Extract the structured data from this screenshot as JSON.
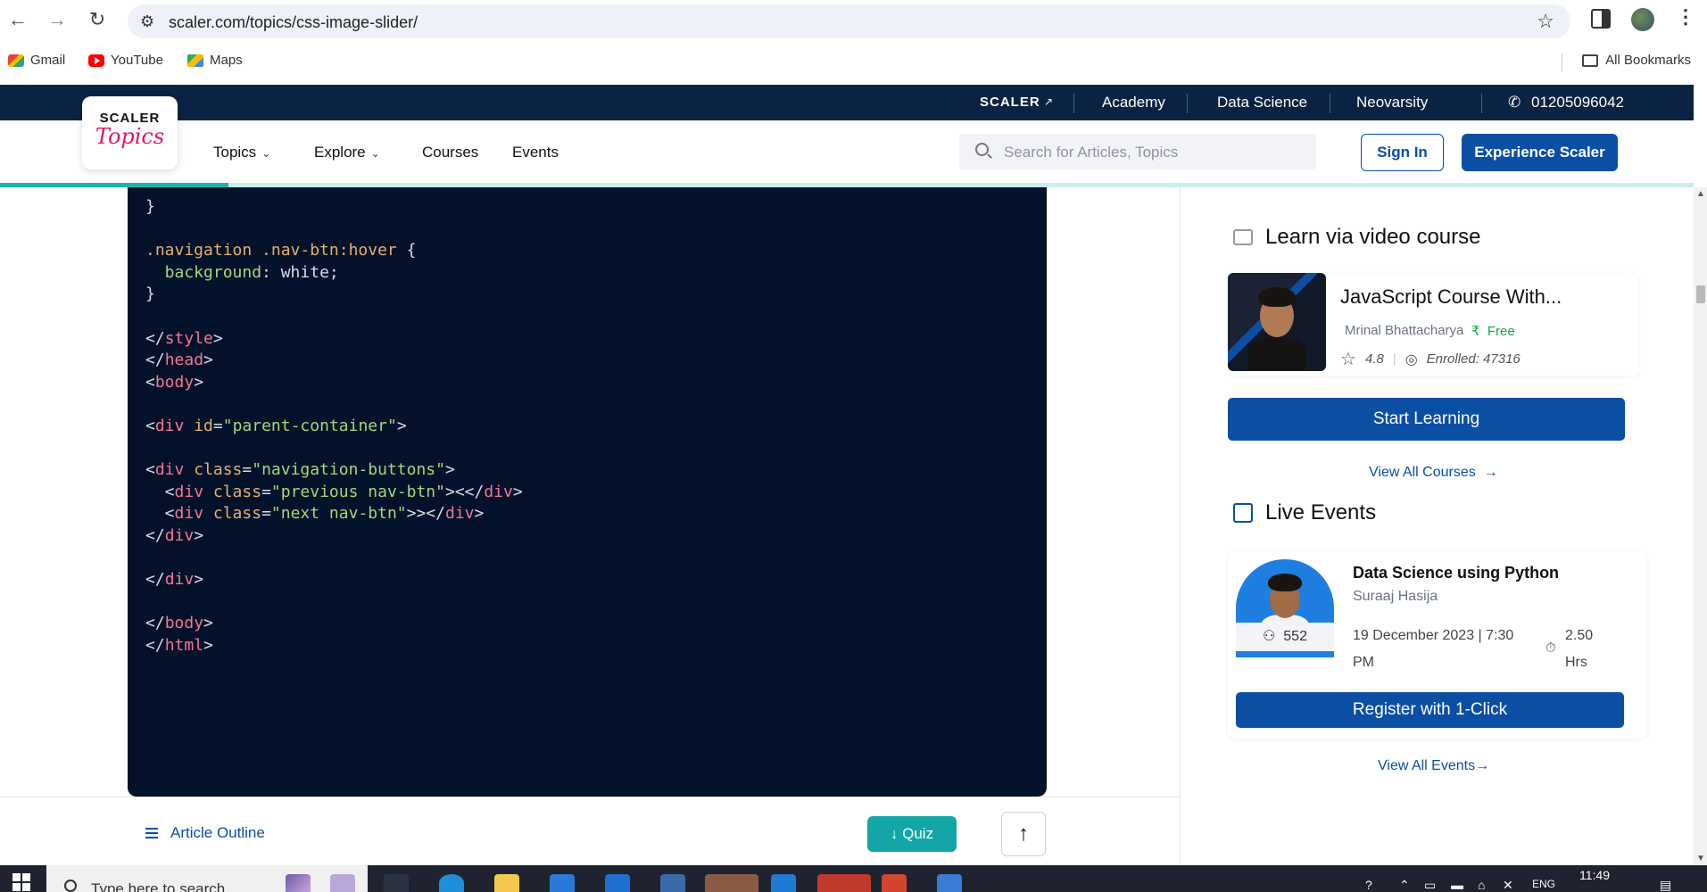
{
  "browser": {
    "url": "scaler.com/topics/css-image-slider/",
    "bookmarks": [
      "Gmail",
      "YouTube",
      "Maps"
    ],
    "all_bookmarks_label": "All Bookmarks"
  },
  "topstrip": {
    "logo": "SCALER",
    "links": [
      "Academy",
      "Data Science",
      "Neovarsity"
    ],
    "phone": "01205096042"
  },
  "nav": {
    "brand_top": "SCALER",
    "brand_bottom": "Topics",
    "items": [
      "Topics",
      "Explore",
      "Courses",
      "Events"
    ],
    "search_placeholder": "Search for Articles, Topics",
    "signin_label": "Sign In",
    "experience_label": "Experience Scaler"
  },
  "reading_progress": 0.135,
  "code_lines": [
    [
      {
        "t": "}",
        "c": "plain"
      }
    ],
    [],
    [
      {
        "t": ".navigation .nav-btn:hover",
        "c": "sel"
      },
      {
        "t": " {",
        "c": "plain"
      }
    ],
    [
      {
        "t": "  background",
        "c": "prop"
      },
      {
        "t": ": white;",
        "c": "plain"
      }
    ],
    [
      {
        "t": "}",
        "c": "plain"
      }
    ],
    [],
    [
      {
        "t": "</",
        "c": "plain"
      },
      {
        "t": "style",
        "c": "tag"
      },
      {
        "t": ">",
        "c": "plain"
      }
    ],
    [
      {
        "t": "</",
        "c": "plain"
      },
      {
        "t": "head",
        "c": "tag"
      },
      {
        "t": ">",
        "c": "plain"
      }
    ],
    [
      {
        "t": "<",
        "c": "plain"
      },
      {
        "t": "body",
        "c": "tag"
      },
      {
        "t": ">",
        "c": "plain"
      }
    ],
    [],
    [
      {
        "t": "<",
        "c": "plain"
      },
      {
        "t": "div",
        "c": "tag"
      },
      {
        "t": " ",
        "c": "plain"
      },
      {
        "t": "id",
        "c": "attr"
      },
      {
        "t": "=",
        "c": "plain"
      },
      {
        "t": "\"parent-container\"",
        "c": "str"
      },
      {
        "t": ">",
        "c": "plain"
      }
    ],
    [],
    [
      {
        "t": "<",
        "c": "plain"
      },
      {
        "t": "div",
        "c": "tag"
      },
      {
        "t": " ",
        "c": "plain"
      },
      {
        "t": "class",
        "c": "attr"
      },
      {
        "t": "=",
        "c": "plain"
      },
      {
        "t": "\"navigation-buttons\"",
        "c": "str"
      },
      {
        "t": ">",
        "c": "plain"
      }
    ],
    [
      {
        "t": "  <",
        "c": "plain"
      },
      {
        "t": "div",
        "c": "tag"
      },
      {
        "t": " ",
        "c": "plain"
      },
      {
        "t": "class",
        "c": "attr"
      },
      {
        "t": "=",
        "c": "plain"
      },
      {
        "t": "\"previous nav-btn\"",
        "c": "str"
      },
      {
        "t": "><</",
        "c": "plain"
      },
      {
        "t": "div",
        "c": "tag"
      },
      {
        "t": ">",
        "c": "plain"
      }
    ],
    [
      {
        "t": "  <",
        "c": "plain"
      },
      {
        "t": "div",
        "c": "tag"
      },
      {
        "t": " ",
        "c": "plain"
      },
      {
        "t": "class",
        "c": "attr"
      },
      {
        "t": "=",
        "c": "plain"
      },
      {
        "t": "\"next nav-btn\"",
        "c": "str"
      },
      {
        "t": ">></",
        "c": "plain"
      },
      {
        "t": "div",
        "c": "tag"
      },
      {
        "t": ">",
        "c": "plain"
      }
    ],
    [
      {
        "t": "</",
        "c": "plain"
      },
      {
        "t": "div",
        "c": "tag"
      },
      {
        "t": ">",
        "c": "plain"
      }
    ],
    [],
    [
      {
        "t": "</",
        "c": "plain"
      },
      {
        "t": "div",
        "c": "tag"
      },
      {
        "t": ">",
        "c": "plain"
      }
    ],
    [],
    [
      {
        "t": "</",
        "c": "plain"
      },
      {
        "t": "body",
        "c": "tag"
      },
      {
        "t": ">",
        "c": "plain"
      }
    ],
    [
      {
        "t": "</",
        "c": "plain"
      },
      {
        "t": "html",
        "c": "tag"
      },
      {
        "t": ">",
        "c": "plain"
      }
    ]
  ],
  "bottombar": {
    "outline_label": "Article Outline",
    "quiz_label": "Quiz"
  },
  "sidebar": {
    "video_heading": "Learn via video course",
    "course": {
      "title": "JavaScript Course With...",
      "instructor": "Mrinal Bhattacharya",
      "price": "Free",
      "rating": "4.8",
      "enrolled": "Enrolled: 47316"
    },
    "start_label": "Start Learning",
    "view_all_courses": "View All Courses",
    "events_heading": "Live Events",
    "event": {
      "title": "Data Science using Python",
      "host": "Suraaj Hasija",
      "attendees": "552",
      "date": "19 December 2023 | 7:30 PM",
      "duration": "2.50 Hrs"
    },
    "register_label": "Register with 1-Click",
    "view_all_events": "View All Events"
  },
  "taskbar": {
    "search_placeholder": "Type here to search",
    "time": "11:49",
    "lang": "ENG"
  },
  "colors": {
    "brand_blue": "#0a4fa4",
    "topstrip": "#0b2342",
    "code_bg": "#03112b",
    "quiz_teal": "#14a6a6",
    "topics_pink": "#e0156b"
  }
}
